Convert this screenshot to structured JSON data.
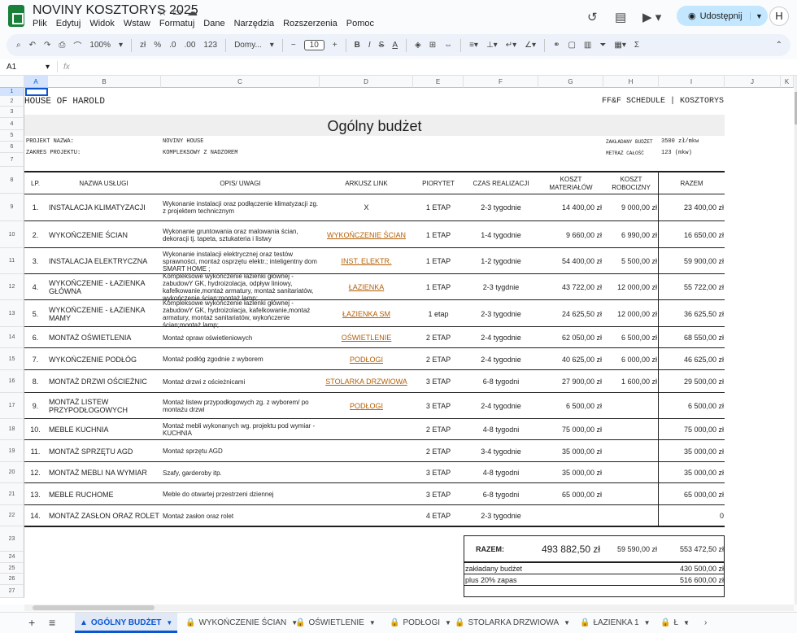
{
  "app": {
    "doc_title": "NOVINY KOSZTORYS 2025",
    "menu": [
      "Plik",
      "Edytuj",
      "Widok",
      "Wstaw",
      "Formatuj",
      "Dane",
      "Narzędzia",
      "Rozszerzenia",
      "Pomoc"
    ],
    "share_label": "Udostępnij",
    "avatar": "H"
  },
  "toolbar": {
    "zoom": "100%",
    "currency": "zł",
    "percent": "%",
    "dec_minus": ".0",
    "dec_plus": ".00",
    "fmt123": "123",
    "font": "Domy...",
    "font_size": "10"
  },
  "formula": {
    "cell_ref": "A1",
    "fx": "fx"
  },
  "columns": [
    "A",
    "B",
    "C",
    "D",
    "E",
    "F",
    "G",
    "H",
    "I",
    "J",
    "K"
  ],
  "rows": [
    "1",
    "2",
    "3",
    "4",
    "5",
    "6",
    "7",
    "8",
    "9",
    "10",
    "11",
    "12",
    "13",
    "14",
    "15",
    "16",
    "17",
    "18",
    "19",
    "20",
    "21",
    "22",
    "23",
    "24",
    "25",
    "26",
    "27"
  ],
  "sheet": {
    "company": "HOUSE OF HAROLD",
    "schedule": "FF&F SCHEDULE | KOSZTORYS",
    "heading": "Ogólny budżet",
    "proj_label": "PROJEKT NAZWA:",
    "proj_val": "NOVINY HOUSE",
    "scope_label": "ZAKRES PROJEKTU:",
    "scope_val": "KOMPLEKSOWY Z NADZOREM",
    "budget_label": "ZAKŁADANY BUDŻET",
    "budget_val": "3500 zł/mkw",
    "area_label": "METRAŻ CAŁOŚĆ",
    "area_val": "123 (mkw)",
    "headers": [
      "LP.",
      "NAZWA USŁUGI",
      "OPIS/ UWAGI",
      "ARKUSZ LINK",
      "PIORYTET",
      "CZAS REALIZACJI",
      "KOSZT\nMATERIAŁÓW",
      "KOSZT\nROBOCIZNY",
      "RAZEM"
    ],
    "items": [
      {
        "lp": "1.",
        "name": "INSTALACJA KLIMATYZACJI",
        "desc": "Wykonanie instalacji oraz podłączenie klimatyzacji zg. z projektem technicznym",
        "link": "X",
        "prio": "1 ETAP",
        "time": "2-3 tygodnie",
        "mat": "14 400,00 zł",
        "lab": "9 000,00 zł",
        "sum": "23 400,00 zł"
      },
      {
        "lp": "2.",
        "name": "WYKOŃCZENIE ŚCIAN",
        "desc": "Wykonanie gruntowania oraz malowania ścian, dekoracji tj. tapeta, sztukateria i listwy",
        "link": "WYKOŃCZENIE ŚCIAN",
        "prio": "1 ETAP",
        "time": "1-4 tygodnie",
        "mat": "9 660,00 zł",
        "lab": "6 990,00 zł",
        "sum": "16 650,00 zł"
      },
      {
        "lp": "3.",
        "name": "INSTALACJA ELEKTRYCZNA",
        "desc": "Wykonanie instalacji elektrycznej oraz testów sprawności, montaż osprzętu elektr.; inteligentny dom SMART HOME ;",
        "link": "INST. ELEKTR.",
        "prio": "1 ETAP",
        "time": "1-2 tygodnie",
        "mat": "54 400,00 zł",
        "lab": "5 500,00 zł",
        "sum": "59 900,00 zł"
      },
      {
        "lp": "4.",
        "name": "WYKOŃCZENIE - ŁAZIENKA GŁÓWNA",
        "desc": " Kompleksowe wykończenie łazienki głównej - zabudowY GK, hydroizolacja, odpływ liniowy, kafelkowanie,montaż armatury, montaż sanitariatów, wykończenie ścian;montaż lamp;",
        "link": "ŁAZIENKA ",
        "prio": "1 ETAP",
        "time": "2-3 tygdnie",
        "mat": "43 722,00 zł",
        "lab": "12 000,00 zł",
        "sum": "55 722,00 zł"
      },
      {
        "lp": "5.",
        "name": "WYKOŃCZENIE - ŁAZIENKA MAMY",
        "desc": " Kompleksowe wykończenie łazienki głównej - zabudowY GK, hydroizolacja, kafelkowanie,montaż armatury, montaż sanitariatów, wykończenie ścian;montaż lamp;",
        "link": "ŁAZIENKA SM",
        "prio": "1 etap",
        "time": "2-3 tygodnie",
        "mat": "24 625,50 zł",
        "lab": "12 000,00 zł",
        "sum": "36 625,50 zł"
      },
      {
        "lp": "6.",
        "name": "MONTAŻ OŚWIETLENIA",
        "desc": "Montaż opraw oświetleniowych",
        "link": "OŚWIETLENIE",
        "prio": "2 ETAP",
        "time": "2-4 tygodnie",
        "mat": "62 050,00 zł",
        "lab": "6 500,00 zł",
        "sum": "68 550,00 zł"
      },
      {
        "lp": "7.",
        "name": "WYKOŃCZENIE PODŁÓG",
        "desc": "Montaż podłóg zgodnie z wyborem",
        "link": "PODŁOGI",
        "prio": "2 ETAP",
        "time": "2-4 tygodnie",
        "mat": "40 625,00 zł",
        "lab": "6 000,00 zł",
        "sum": "46 625,00 zł"
      },
      {
        "lp": "8.",
        "name": "MONTAŻ DRZWI OŚCIEŻNIC",
        "desc": "Montaż drzwi z ościeżnicami",
        "link": "STOLARKA DRZWIOWA",
        "prio": "3 ETAP",
        "time": "6-8 tygodni",
        "mat": "27 900,00 zł",
        "lab": "1 600,00 zł",
        "sum": "29 500,00 zł"
      },
      {
        "lp": "9.",
        "name": "MONTAŻ LISTEW PRZYPODŁOGOWYCH",
        "desc": "Montaż listew przypodłogowych zg. z wyborem/ po montażu drzwi",
        "link": "PODŁOGI",
        "prio": "3 ETAP",
        "time": "2-4 tygodnie",
        "mat": "6 500,00 zł",
        "lab": "",
        "sum": "6 500,00 zł"
      },
      {
        "lp": "10.",
        "name": "MEBLE KUCHNIA",
        "desc": "Montaż mebli wykonanych wg. projektu pod wymiar - KUCHNIA",
        "link": "",
        "prio": "2 ETAP",
        "time": "4-8 tygodni",
        "mat": "75 000,00 zł",
        "lab": "",
        "sum": "75 000,00 zł"
      },
      {
        "lp": "11.",
        "name": "MONTAŻ SPRZĘTU AGD",
        "desc": "Montaż sprzętu AGD",
        "link": "",
        "prio": "2 ETAP",
        "time": "3-4 tygodnie",
        "mat": "35 000,00 zł",
        "lab": "",
        "sum": "35 000,00 zł"
      },
      {
        "lp": "12.",
        "name": "MONTAŻ MEBLI NA WYMIAR",
        "desc": "Szafy, garderoby itp.",
        "link": "",
        "prio": "3 ETAP",
        "time": "4-8 tygodni",
        "mat": "35 000,00 zł",
        "lab": "",
        "sum": "35 000,00 zł"
      },
      {
        "lp": "13.",
        "name": "MEBLE RUCHOME",
        "desc": "Meble do otwartej przestrzeni dziennej",
        "link": "",
        "prio": "3 ETAP",
        "time": "6-8 tygodni",
        "mat": "65 000,00 zł",
        "lab": "",
        "sum": "65 000,00 zł"
      },
      {
        "lp": "14.",
        "name": "MONTAŻ ZASŁON ORAZ ROLET",
        "desc": "Montaż zasłon oraz rolet",
        "link": "",
        "prio": "4 ETAP",
        "time": "2-3 tygodnie",
        "mat": "",
        "lab": "",
        "sum": "0"
      }
    ],
    "total_label": "RAZEM:",
    "total_mat": "493 882,50 zł",
    "total_lab": "59 590,00 zł",
    "total_sum": "553 472,50 zł",
    "assumed_label": "zakładany budżet",
    "assumed_val": "430 500,00 zł",
    "reserve_label": "plus 20% zapas",
    "reserve_val": "516 600,00 zł"
  },
  "tabs": [
    {
      "label": "OGÓLNY BUDŻET"
    },
    {
      "label": "WYKOŃCZENIE ŚCIAN"
    },
    {
      "label": "OŚWIETLENIE"
    },
    {
      "label": "PODŁOGI"
    },
    {
      "label": "STOLARKA DRZWIOWA"
    },
    {
      "label": "ŁAZIENKA 1"
    },
    {
      "label": "Ł"
    }
  ]
}
